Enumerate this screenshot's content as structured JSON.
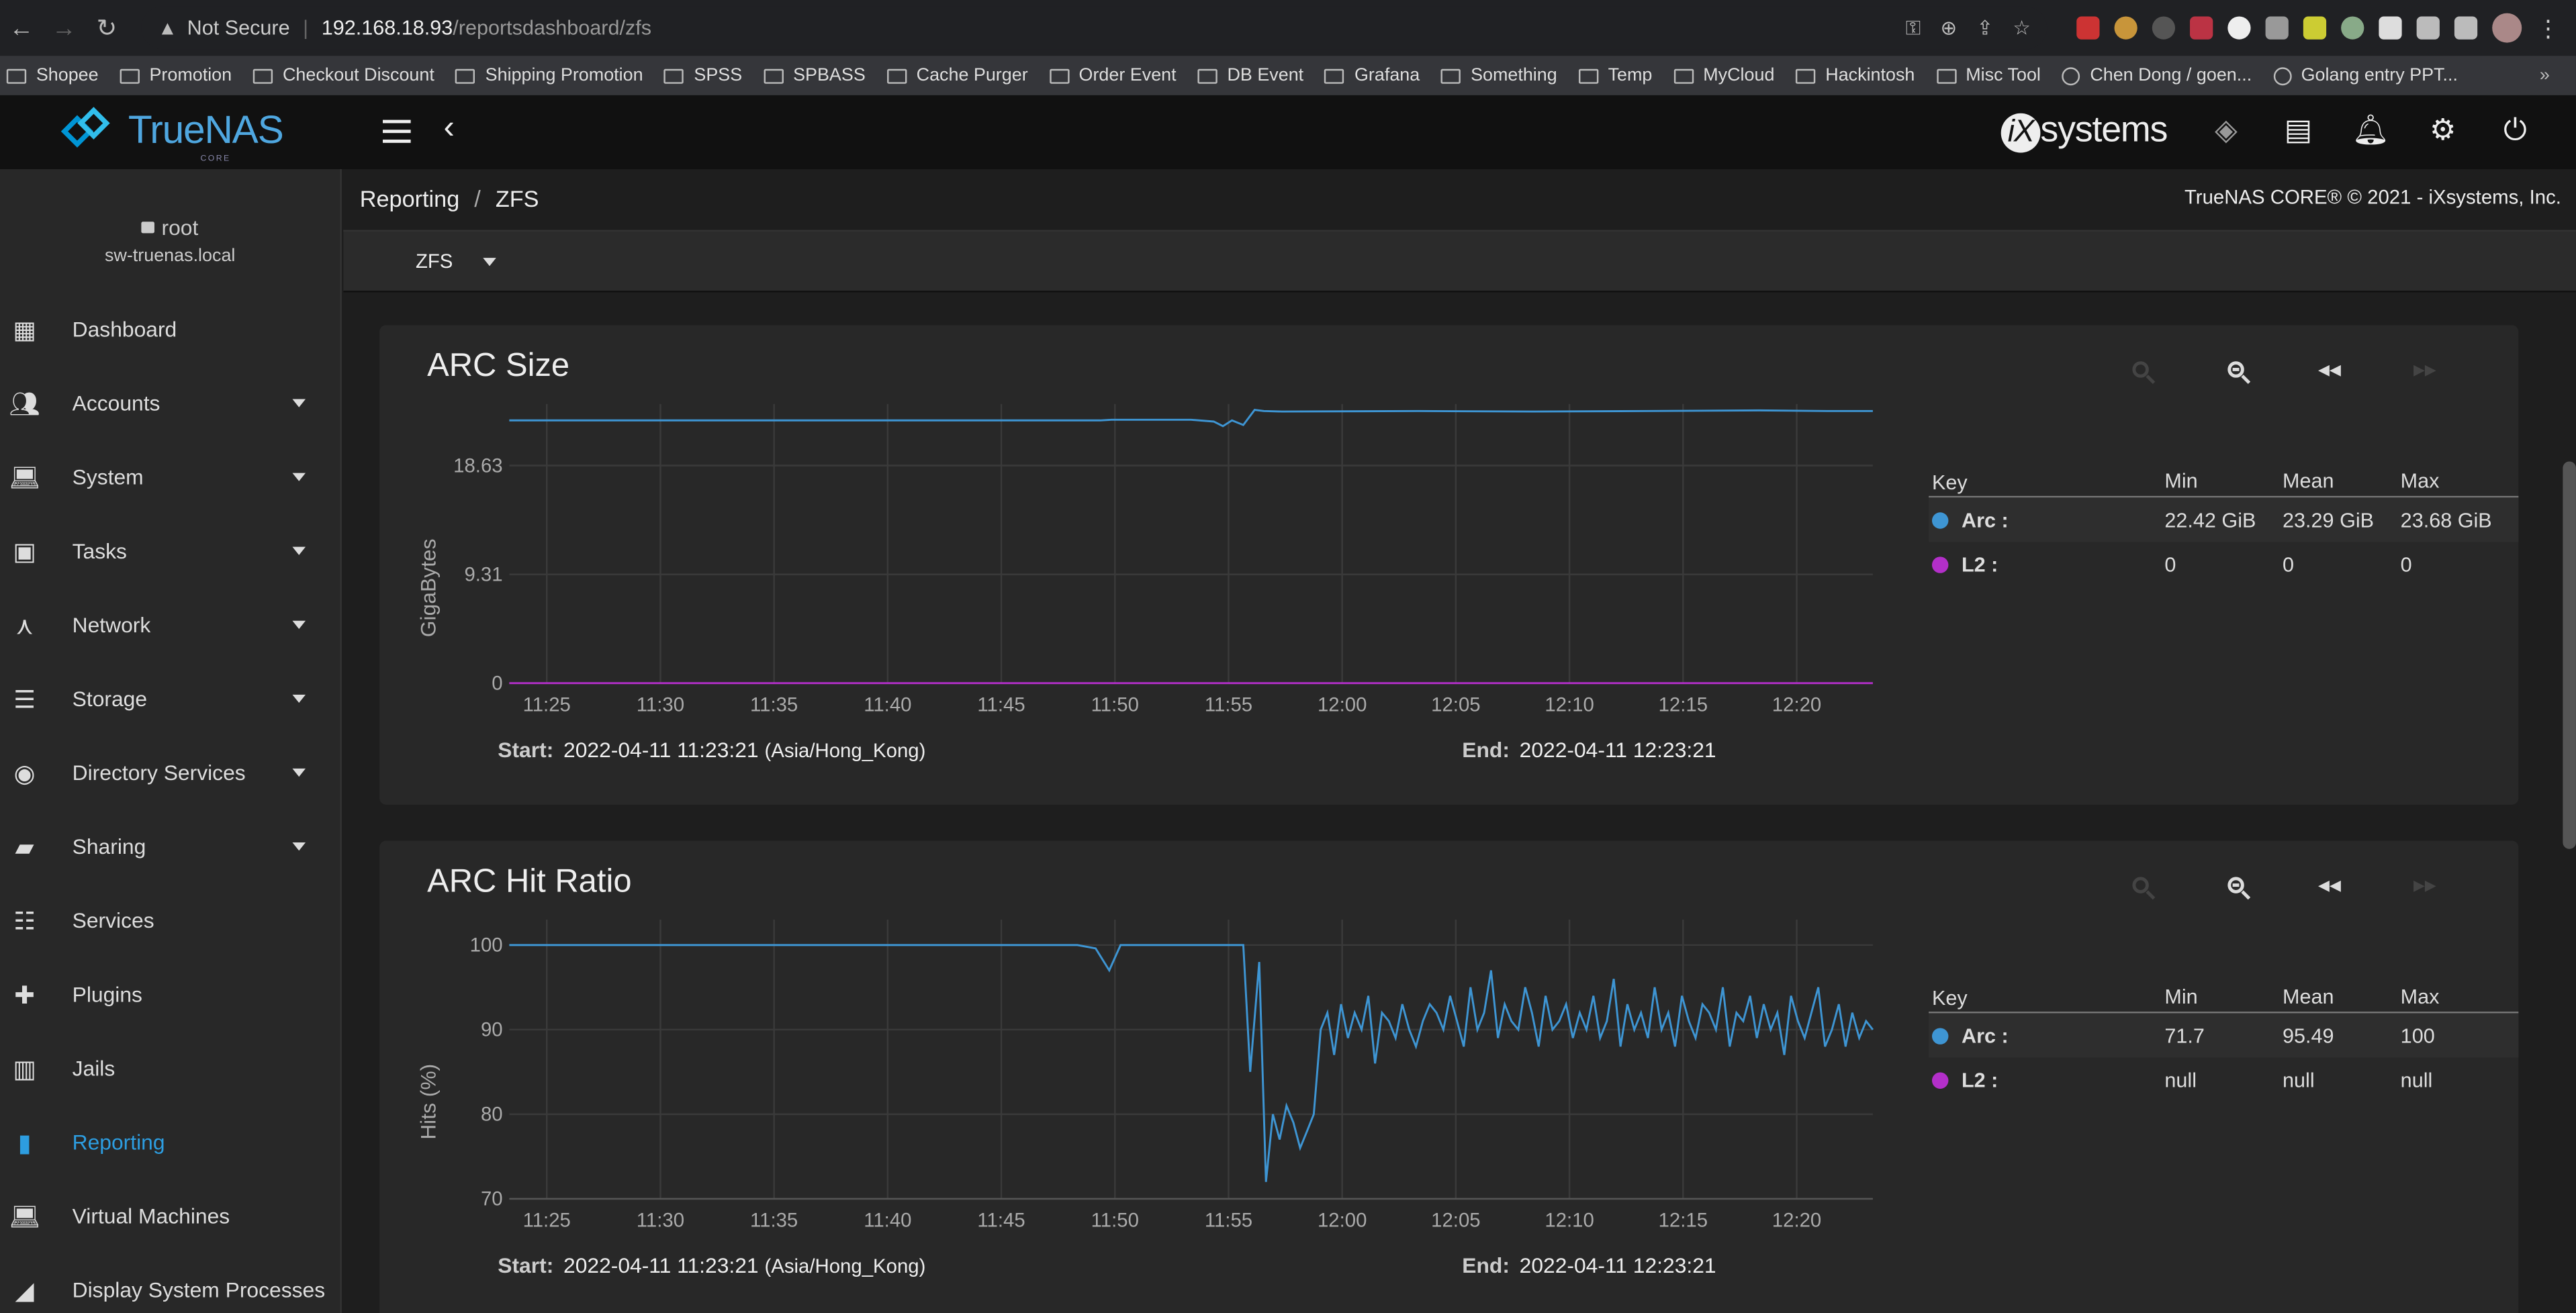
{
  "browser": {
    "security": "Not Secure",
    "url_host": "192.168.18.93",
    "url_path": "/reportsdashboard/zfs",
    "bookmarks": [
      {
        "label": "Shopee",
        "type": "folder"
      },
      {
        "label": "Promotion",
        "type": "folder"
      },
      {
        "label": "Checkout Discount",
        "type": "folder"
      },
      {
        "label": "Shipping Promotion",
        "type": "folder"
      },
      {
        "label": "SPSS",
        "type": "folder"
      },
      {
        "label": "SPBASS",
        "type": "folder"
      },
      {
        "label": "Cache Purger",
        "type": "folder"
      },
      {
        "label": "Order Event",
        "type": "folder"
      },
      {
        "label": "DB Event",
        "type": "folder"
      },
      {
        "label": "Grafana",
        "type": "folder"
      },
      {
        "label": "Something",
        "type": "folder"
      },
      {
        "label": "Temp",
        "type": "folder"
      },
      {
        "label": "MyCloud",
        "type": "folder"
      },
      {
        "label": "Hackintosh",
        "type": "folder"
      },
      {
        "label": "Misc Tool",
        "type": "folder"
      },
      {
        "label": "Chen Dong / goen...",
        "type": "link"
      },
      {
        "label": "Golang entry PPT...",
        "type": "link"
      }
    ],
    "more": "»"
  },
  "header": {
    "logo_text": "TrueNAS",
    "logo_sub": "CORE",
    "vendor_logo": "systems"
  },
  "sidebar": {
    "user": "root",
    "host": "sw-truenas.local",
    "items": [
      {
        "label": "Dashboard",
        "icon": "dashboard-icon",
        "caret": false
      },
      {
        "label": "Accounts",
        "icon": "people-icon",
        "caret": true
      },
      {
        "label": "System",
        "icon": "laptop-icon",
        "caret": true
      },
      {
        "label": "Tasks",
        "icon": "calendar-icon",
        "caret": true
      },
      {
        "label": "Network",
        "icon": "network-icon",
        "caret": true
      },
      {
        "label": "Storage",
        "icon": "storage-icon",
        "caret": true
      },
      {
        "label": "Directory Services",
        "icon": "directory-icon",
        "caret": true
      },
      {
        "label": "Sharing",
        "icon": "share-icon",
        "caret": true
      },
      {
        "label": "Services",
        "icon": "tune-icon",
        "caret": false
      },
      {
        "label": "Plugins",
        "icon": "puzzle-icon",
        "caret": false
      },
      {
        "label": "Jails",
        "icon": "jail-icon",
        "caret": false
      },
      {
        "label": "Reporting",
        "icon": "chart-icon",
        "caret": false,
        "active": true
      },
      {
        "label": "Virtual Machines",
        "icon": "laptop-icon",
        "caret": false
      },
      {
        "label": "Display System Processes",
        "icon": "processes-icon",
        "caret": false
      }
    ]
  },
  "page": {
    "breadcrumb": [
      "Reporting",
      "ZFS"
    ],
    "copyright": "TrueNAS CORE® © 2021 - iXsystems, Inc.",
    "selector": "ZFS"
  },
  "legend_headers": {
    "key": "Key",
    "min": "Min",
    "mean": "Mean",
    "max": "Max"
  },
  "cards": [
    {
      "title": "ARC Size",
      "start_label": "Start:",
      "start": "2022-04-11 11:23:21",
      "timezone": "(Asia/Hong_Kong)",
      "end_label": "End:",
      "end": "2022-04-11 12:23:21",
      "legend": [
        {
          "name": "Arc :",
          "color": "#3e95d3",
          "min": "22.42 GiB",
          "mean": "23.29 GiB",
          "max": "23.68 GiB"
        },
        {
          "name": "L2 :",
          "color": "#b32fc9",
          "min": "0",
          "mean": "0",
          "max": "0"
        }
      ]
    },
    {
      "title": "ARC Hit Ratio",
      "start_label": "Start:",
      "start": "2022-04-11 11:23:21",
      "timezone": "(Asia/Hong_Kong)",
      "end_label": "End:",
      "end": "2022-04-11 12:23:21",
      "legend": [
        {
          "name": "Arc :",
          "color": "#3e95d3",
          "min": "71.7",
          "mean": "95.49",
          "max": "100"
        },
        {
          "name": "L2 :",
          "color": "#b32fc9",
          "min": "null",
          "mean": "null",
          "max": "null"
        }
      ]
    }
  ],
  "chart_data": [
    {
      "type": "line",
      "title": "ARC Size",
      "ylabel": "GigaBytes",
      "y_ticks": [
        "0",
        "9.31",
        "18.63"
      ],
      "y_tick_values": [
        0,
        9.31,
        18.63
      ],
      "ylim": [
        0,
        23.9
      ],
      "x_ticks": [
        "11:25",
        "11:30",
        "11:35",
        "11:40",
        "11:45",
        "11:50",
        "11:55",
        "12:00",
        "12:05",
        "12:10",
        "12:15",
        "12:20"
      ],
      "x_tick_values": [
        1.65,
        6.65,
        11.65,
        16.65,
        21.65,
        26.65,
        31.65,
        36.65,
        41.65,
        46.65,
        51.65,
        56.65
      ],
      "xlim": [
        0,
        60
      ],
      "grid": true,
      "series": [
        {
          "name": "Arc",
          "color": "#3e95d3",
          "x": [
            0,
            26,
            26.5,
            30,
            31,
            31.4,
            31.8,
            32.3,
            32.8,
            33.2,
            34,
            40,
            45,
            50,
            55,
            58,
            60
          ],
          "y": [
            22.5,
            22.5,
            22.55,
            22.55,
            22.4,
            22.0,
            22.5,
            22.1,
            23.4,
            23.3,
            23.25,
            23.3,
            23.25,
            23.3,
            23.35,
            23.3,
            23.3
          ]
        },
        {
          "name": "L2",
          "color": "#b32fc9",
          "x": [
            0,
            60
          ],
          "y": [
            0,
            0
          ]
        }
      ]
    },
    {
      "type": "line",
      "title": "ARC Hit Ratio",
      "ylabel": "Hits (%)",
      "y_ticks": [
        "70",
        "80",
        "90",
        "100"
      ],
      "y_tick_values": [
        70,
        80,
        90,
        100
      ],
      "ylim": [
        70,
        103
      ],
      "x_ticks": [
        "11:25",
        "11:30",
        "11:35",
        "11:40",
        "11:45",
        "11:50",
        "11:55",
        "12:00",
        "12:05",
        "12:10",
        "12:15",
        "12:20"
      ],
      "x_tick_values": [
        1.65,
        6.65,
        11.65,
        16.65,
        21.65,
        26.65,
        31.65,
        36.65,
        41.65,
        46.65,
        51.65,
        56.65
      ],
      "xlim": [
        0,
        60
      ],
      "grid": true,
      "series": [
        {
          "name": "Arc",
          "color": "#3e95d3",
          "x": [
            0,
            25,
            25.8,
            26.4,
            26.9,
            27.5,
            29,
            31,
            32.3,
            32.6,
            33,
            33.3,
            33.6,
            33.9,
            34.2,
            34.5,
            34.8,
            35.1,
            35.4,
            35.7,
            36,
            36.3,
            36.6,
            36.9,
            37.2,
            37.5,
            37.8,
            38.1,
            38.4,
            38.7,
            39,
            39.3,
            39.6,
            39.9,
            40.2,
            40.5,
            40.8,
            41.1,
            41.4,
            41.7,
            42,
            42.3,
            42.6,
            42.9,
            43.2,
            43.5,
            43.8,
            44.1,
            44.4,
            44.7,
            45,
            45.3,
            45.6,
            45.9,
            46.2,
            46.5,
            46.8,
            47.1,
            47.4,
            47.7,
            48,
            48.3,
            48.6,
            48.9,
            49.2,
            49.5,
            49.8,
            50.1,
            50.4,
            50.7,
            51,
            51.3,
            51.6,
            51.9,
            52.2,
            52.5,
            52.8,
            53.1,
            53.4,
            53.7,
            54,
            54.3,
            54.6,
            54.9,
            55.2,
            55.5,
            55.8,
            56.1,
            56.4,
            56.7,
            57,
            57.3,
            57.6,
            57.9,
            58.2,
            58.5,
            58.8,
            59.1,
            59.4,
            59.7,
            60
          ],
          "y": [
            100,
            100,
            99.6,
            97,
            100,
            100,
            100,
            100,
            100,
            85,
            98,
            72,
            80,
            77,
            81,
            79,
            76,
            78,
            80,
            90,
            92,
            87,
            93,
            89,
            92,
            90,
            94,
            86,
            92,
            91,
            89,
            93,
            90,
            88,
            91,
            93,
            92,
            90,
            94,
            91,
            88,
            95,
            90,
            92,
            97,
            89,
            93,
            91,
            90,
            95,
            92,
            88,
            94,
            90,
            91,
            93,
            89,
            92,
            90,
            94,
            89,
            91,
            96,
            88,
            93,
            90,
            92,
            89,
            95,
            90,
            92,
            88,
            94,
            91,
            89,
            93,
            92,
            90,
            95,
            88,
            92,
            91,
            94,
            89,
            93,
            90,
            92,
            87,
            94,
            91,
            89,
            92,
            95,
            88,
            90,
            93,
            88,
            92,
            89,
            91,
            90
          ]
        },
        {
          "name": "L2",
          "color": "#b32fc9",
          "x": [],
          "y": []
        }
      ]
    }
  ]
}
